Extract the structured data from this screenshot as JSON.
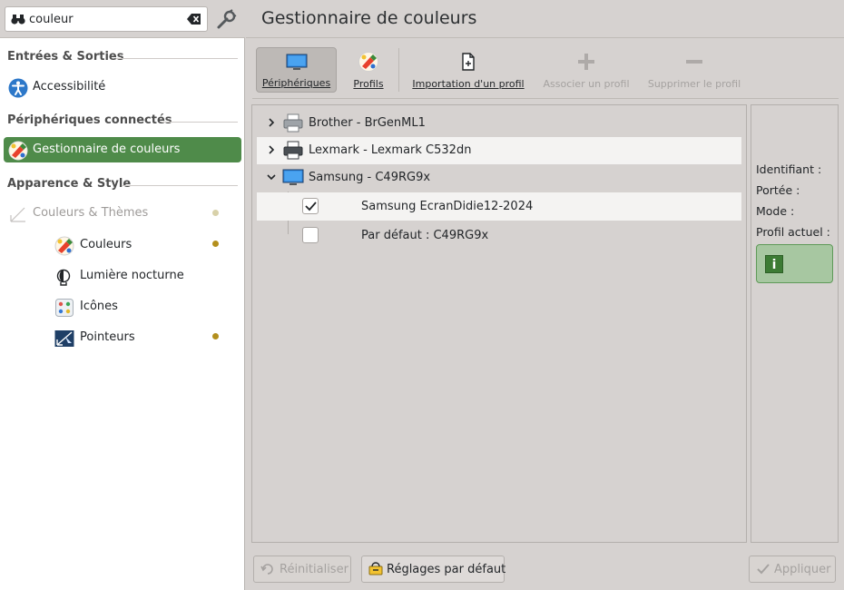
{
  "search": {
    "value": "couleur"
  },
  "sidebar": {
    "sections": [
      {
        "title": "Entrées & Sorties"
      },
      {
        "title": "Périphériques connectés"
      },
      {
        "title": "Apparence & Style"
      }
    ],
    "items": [
      {
        "label": "Accessibilité",
        "icon": "accessibility-icon"
      },
      {
        "label": "Gestionnaire de couleurs",
        "icon": "color-manager-icon",
        "selected": true
      },
      {
        "label": "Couleurs & Thèmes",
        "icon": "themes-icon",
        "disabled": true
      }
    ],
    "subitems": [
      {
        "label": "Couleurs",
        "icon": "colors-icon",
        "dot": true
      },
      {
        "label": "Lumière nocturne",
        "icon": "night-light-icon",
        "dot": false
      },
      {
        "label": "Icônes",
        "icon": "icons-icon",
        "dot": false
      },
      {
        "label": "Pointeurs",
        "icon": "cursors-icon",
        "dot": true
      }
    ]
  },
  "page": {
    "title": "Gestionnaire de couleurs"
  },
  "toolbar": {
    "devices": "Périphériques",
    "profiles": "Profils",
    "import": "Importation d'un profil",
    "assign": "Associer un profil",
    "remove": "Supprimer le profil"
  },
  "devices": [
    {
      "name": "Brother - BrGenML1",
      "type": "printer",
      "expanded": false
    },
    {
      "name": "Lexmark - Lexmark C532dn",
      "type": "printer",
      "expanded": false
    },
    {
      "name": "Samsung - C49RG9x",
      "type": "display",
      "expanded": true,
      "profiles": [
        {
          "name": "Samsung EcranDidie12-2024",
          "checked": true
        },
        {
          "name": "Par défaut : C49RG9x",
          "checked": false
        }
      ]
    }
  ],
  "info": {
    "id_label": "Identifiant :",
    "scope_label": "Portée :",
    "mode_label": "Mode :",
    "current_profile_label": "Profil actuel :"
  },
  "buttons": {
    "reset": "Réinitialiser",
    "defaults": "Réglages par défaut",
    "apply": "Appliquer"
  },
  "colors": {
    "accent": "#4f8b4a",
    "dot": "#b38f1d"
  }
}
